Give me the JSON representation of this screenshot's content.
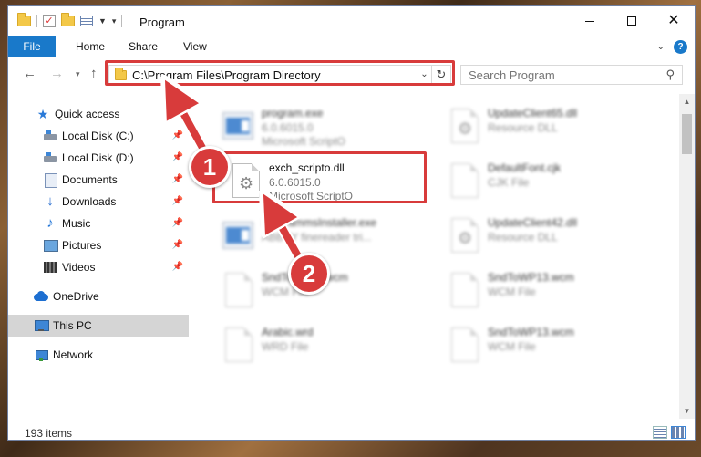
{
  "window": {
    "title": "Program",
    "controls": {
      "minimize": "—",
      "maximize": "☐",
      "close": "✕"
    }
  },
  "ribbon": {
    "tabs": [
      "File",
      "Home",
      "Share",
      "View"
    ],
    "help": "?"
  },
  "navigation": {
    "address": "C:\\Program Files\\Program Directory",
    "search_placeholder": "Search Program"
  },
  "sidebar": {
    "items": [
      {
        "label": "Quick access",
        "icon": "star-icon",
        "pinned": false,
        "selected": false
      },
      {
        "label": "Local Disk (C:)",
        "icon": "disk-icon",
        "pinned": true,
        "selected": false
      },
      {
        "label": "Local Disk (D:)",
        "icon": "disk-icon",
        "pinned": true,
        "selected": false
      },
      {
        "label": "Documents",
        "icon": "document-icon",
        "pinned": true,
        "selected": false
      },
      {
        "label": "Downloads",
        "icon": "download-icon",
        "pinned": true,
        "selected": false
      },
      {
        "label": "Music",
        "icon": "music-icon",
        "pinned": true,
        "selected": false
      },
      {
        "label": "Pictures",
        "icon": "pictures-icon",
        "pinned": true,
        "selected": false
      },
      {
        "label": "Videos",
        "icon": "videos-icon",
        "pinned": true,
        "selected": false
      },
      {
        "label": "OneDrive",
        "icon": "cloud-icon",
        "pinned": false,
        "selected": false
      },
      {
        "label": "This PC",
        "icon": "computer-icon",
        "pinned": false,
        "selected": true
      },
      {
        "label": "Network",
        "icon": "network-icon",
        "pinned": false,
        "selected": false
      }
    ]
  },
  "files": {
    "left": [
      {
        "name": "program.exe",
        "sub1": "6.0.6015.0",
        "sub2": "Microsoft ScriptO",
        "icon": "exe-icon",
        "blurred": true
      },
      {
        "name": "exch_scripto.dll",
        "sub1": "6.0.6015.0",
        "sub2": "Microsoft ScriptO",
        "icon": "dll-gear-icon",
        "blurred": false
      },
      {
        "name": "ProgrammsInstaller.exe",
        "sub1": "ABBYY finereader tri...",
        "sub2": "",
        "icon": "exe-icon",
        "blurred": true
      },
      {
        "name": "SndToWP13.wcm",
        "sub1": "WCM File",
        "sub2": "",
        "icon": "document-icon",
        "blurred": true
      },
      {
        "name": "Arabic.wrd",
        "sub1": "WRD File",
        "sub2": "",
        "icon": "document-icon",
        "blurred": true
      }
    ],
    "right": [
      {
        "name": "UpdateClient65.dll",
        "sub1": "Resource DLL",
        "icon": "dll-gear-icon"
      },
      {
        "name": "DefaultFont.cjk",
        "sub1": "CJK File",
        "icon": "document-icon"
      },
      {
        "name": "UpdateClient42.dll",
        "sub1": "Resource DLL",
        "icon": "dll-gear-icon"
      },
      {
        "name": "SndToWP13.wcm",
        "sub1": "WCM File",
        "icon": "document-icon"
      },
      {
        "name": "SndToWP13.wcm",
        "sub1": "WCM File",
        "icon": "document-icon"
      }
    ]
  },
  "status": {
    "items_count": "193 items"
  },
  "annotations": {
    "step1": "1",
    "step2": "2",
    "color": "#d83b3b"
  }
}
